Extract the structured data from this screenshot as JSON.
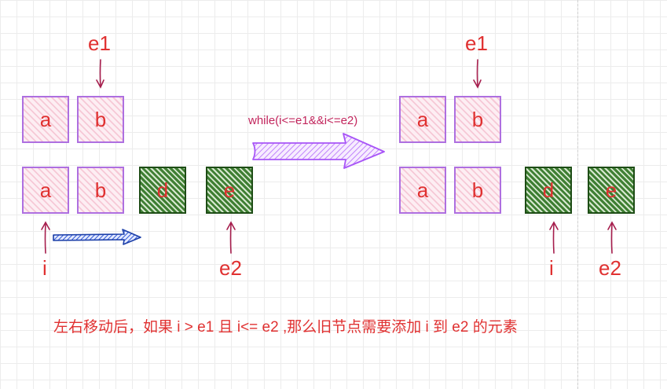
{
  "left_panel": {
    "label_e1": "e1",
    "top_row": [
      "a",
      "b"
    ],
    "bottom_row": [
      "a",
      "b",
      "d",
      "e"
    ],
    "label_i": "i",
    "label_e2": "e2"
  },
  "transition": {
    "condition": "while(i<=e1&&i<=e2)"
  },
  "right_panel": {
    "label_e1": "e1",
    "top_row": [
      "a",
      "b"
    ],
    "bottom_row": [
      "a",
      "b",
      "d",
      "e"
    ],
    "label_i": "i",
    "label_e2": "e2"
  },
  "caption": "左右移动后，如果 i > e1 且 i<= e2 ,那么旧节点需要添加 i 到 e2 的元素",
  "colors": {
    "label_red": "#e03131",
    "pink_border": "#ae6fe0",
    "green_border": "#1e4d16",
    "pointer_arrow": "#a61e4d",
    "big_arrow": "#a855f7",
    "move_arrow": "#1c3fa8"
  }
}
